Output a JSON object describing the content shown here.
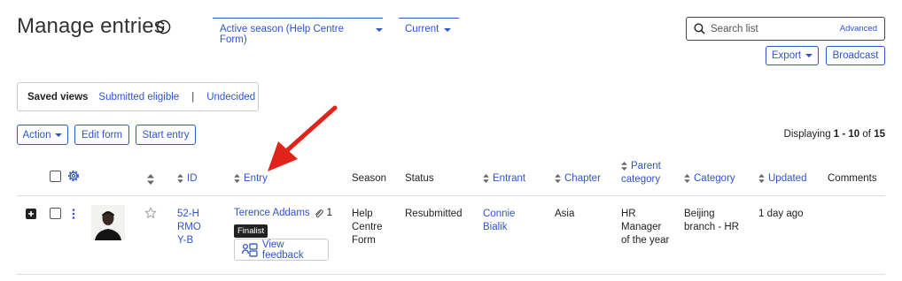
{
  "page": {
    "title": "Manage entries",
    "season_tab": "Active season (Help Centre Form)",
    "current_tab": "Current"
  },
  "search": {
    "placeholder": "Search list",
    "advanced": "Advanced"
  },
  "buttons": {
    "export": "Export",
    "broadcast": "Broadcast",
    "action": "Action",
    "edit_form": "Edit form",
    "start_entry": "Start entry"
  },
  "saved_views": {
    "label": "Saved views",
    "items": [
      "Submitted eligible",
      "|",
      "Undecided"
    ]
  },
  "displaying": {
    "prefix": "Displaying ",
    "range": "1 - 10",
    "mid": " of ",
    "total": "15"
  },
  "columns": [
    "ID",
    "Entry",
    "Season",
    "Status",
    "Entrant",
    "Chapter",
    "Parent category",
    "Category",
    "Updated",
    "Comments"
  ],
  "row": {
    "id": "52-HRMOY-B",
    "entry": "Terence Addams",
    "attachments": "1",
    "badge": "Finalist",
    "feedback": "View feedback",
    "season": "Help Centre Form",
    "status": "Resubmitted",
    "entrant": "Connie Bialik",
    "chapter": "Asia",
    "parent_category": "HR Manager of the year",
    "category": "Beijing branch - HR",
    "updated": "1 day ago"
  },
  "colors": {
    "accent": "#2f55c9",
    "annotation": "#e0241c"
  }
}
